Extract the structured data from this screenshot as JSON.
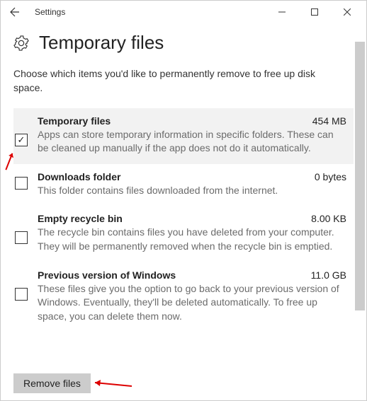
{
  "window": {
    "title": "Settings"
  },
  "header": {
    "title": "Temporary files"
  },
  "description": "Choose which items you'd like to permanently remove to free up disk space.",
  "items": [
    {
      "title": "Temporary files",
      "size": "454 MB",
      "desc": "Apps can store temporary information in specific folders. These can be cleaned up manually if the app does not do it automatically.",
      "checked": true,
      "highlight": true
    },
    {
      "title": "Downloads folder",
      "size": "0 bytes",
      "desc": "This folder contains files downloaded from the internet.",
      "checked": false
    },
    {
      "title": "Empty recycle bin",
      "size": "8.00 KB",
      "desc": "The recycle bin contains files you have deleted from your computer. They will be permanently removed when the recycle bin is emptied.",
      "checked": false
    },
    {
      "title": "Previous version of Windows",
      "size": "11.0 GB",
      "desc": "These files give you the option to go back to your previous version of Windows. Eventually, they'll be deleted automatically. To free up space, you can delete them now.",
      "checked": false
    }
  ],
  "actions": {
    "remove_label": "Remove files"
  }
}
